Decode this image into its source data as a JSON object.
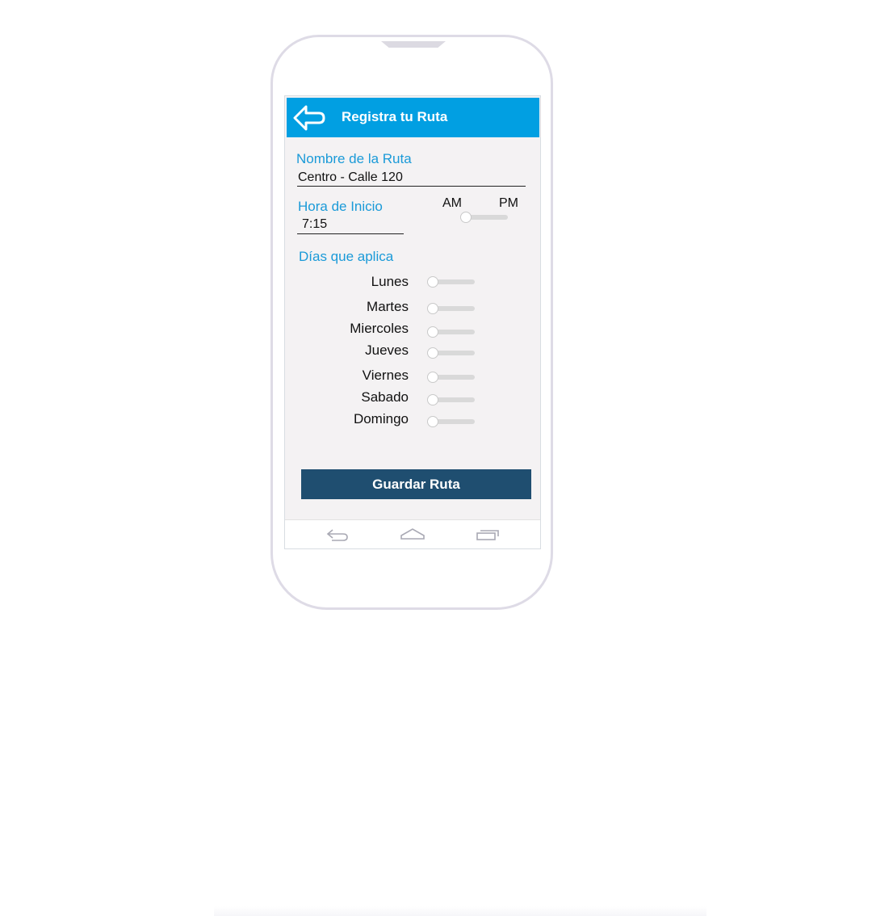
{
  "appbar": {
    "title": "Registra tu Ruta"
  },
  "route_name": {
    "label": "Nombre de la Ruta",
    "value": "Centro - Calle 120"
  },
  "start_time": {
    "label": "Hora de Inicio",
    "value": "7:15",
    "am_label": "AM",
    "pm_label": "PM",
    "ampm_toggle": "AM"
  },
  "days": {
    "label": "Días que aplica",
    "items": [
      {
        "label": "Lunes",
        "on": false
      },
      {
        "label": "Martes",
        "on": false
      },
      {
        "label": "Miercoles",
        "on": false
      },
      {
        "label": "Jueves",
        "on": false
      },
      {
        "label": "Viernes",
        "on": false
      },
      {
        "label": "Sabado",
        "on": false
      },
      {
        "label": "Domingo",
        "on": false
      }
    ]
  },
  "save_button": {
    "label": "Guardar Ruta"
  },
  "colors": {
    "appbar": "#019fe2",
    "label": "#1a9ad8",
    "button": "#1f4e70",
    "screen_bg": "#f4f2f3"
  },
  "icons": {
    "back": "back-arrow-icon",
    "nav_back": "nav-back-icon",
    "nav_home": "nav-home-icon",
    "nav_recents": "nav-recents-icon"
  }
}
